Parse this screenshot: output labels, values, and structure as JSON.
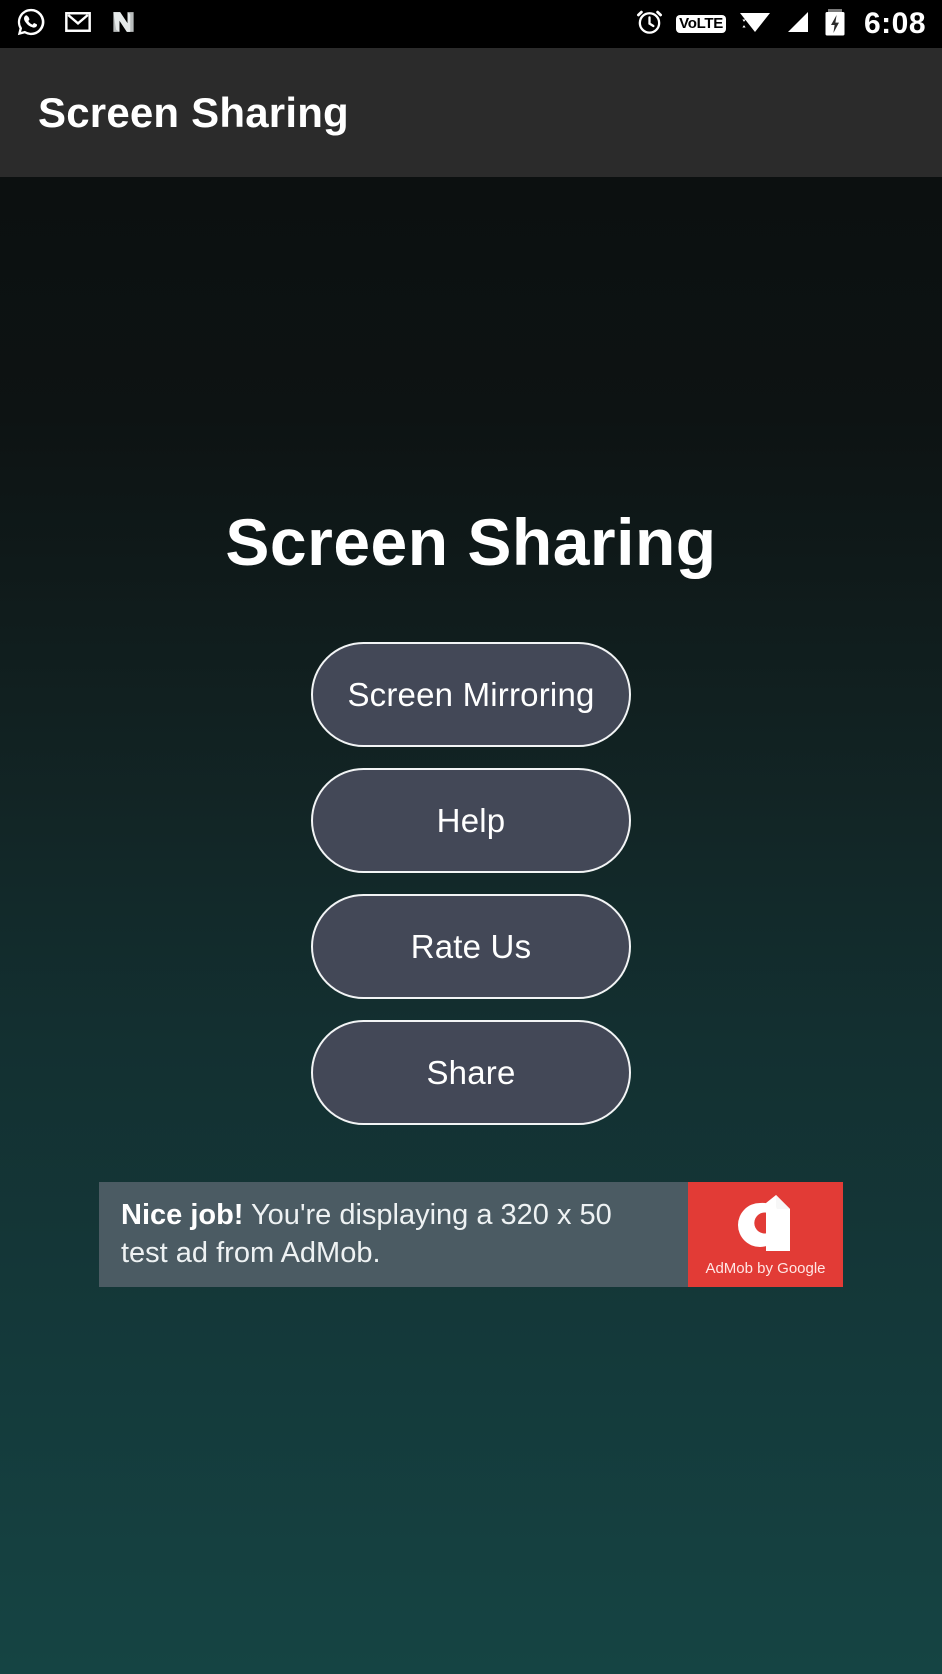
{
  "status_bar": {
    "left_icons": [
      {
        "name": "whatsapp-icon",
        "label": "WhatsApp"
      },
      {
        "name": "gmail-icon",
        "label": "Gmail"
      },
      {
        "name": "nova-launcher-icon",
        "label": "N"
      }
    ],
    "right_icons": [
      {
        "name": "alarm-clock-icon",
        "label": "Alarm"
      },
      {
        "name": "volte-icon",
        "label_primary": "Vo",
        "label_secondary": "LTE"
      },
      {
        "name": "wifi-icon",
        "label": "Wi-Fi"
      },
      {
        "name": "cellular-signal-icon",
        "label": "Signal"
      },
      {
        "name": "battery-charging-icon",
        "label": "Charging"
      }
    ],
    "clock": "6:08"
  },
  "app_bar": {
    "title": "Screen Sharing"
  },
  "main": {
    "heading": "Screen Sharing",
    "buttons": [
      {
        "name": "screen-mirroring-button",
        "label": "Screen Mirroring"
      },
      {
        "name": "help-button",
        "label": "Help"
      },
      {
        "name": "rate-us-button",
        "label": "Rate Us"
      },
      {
        "name": "share-button",
        "label": "Share"
      }
    ]
  },
  "ad": {
    "headline": "Nice job!",
    "body": " You're displaying a 320 x 50 test ad from AdMob.",
    "logo_caption": "AdMob by Google",
    "logo_color": "#e23b36",
    "background_color": "#4b5b63"
  },
  "theme": {
    "status_bar_bg": "#000000",
    "app_bar_bg": "#2b2b2b",
    "gradient_top": "#0c1010",
    "gradient_bottom": "#154443",
    "button_fill": "#434857",
    "button_border": "#f2f4f5",
    "text_primary": "#ffffff"
  }
}
